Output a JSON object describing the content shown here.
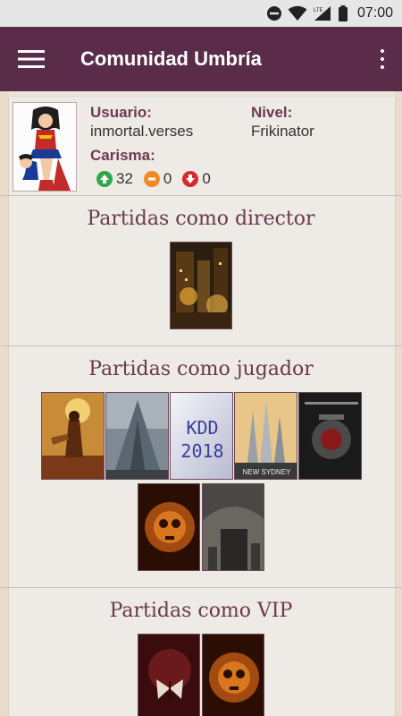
{
  "status_bar": {
    "time": "07:00",
    "icons": [
      "do-not-disturb-icon",
      "wifi-icon",
      "lte-signal-icon",
      "battery-icon"
    ],
    "network": "LTE"
  },
  "app_bar": {
    "title": "Comunidad Umbría",
    "menu_icon": "hamburger-menu-icon",
    "overflow_icon": "more-vertical-icon"
  },
  "profile": {
    "user_label": "Usuario:",
    "user_value": "inmortal.verses",
    "level_label": "Nivel:",
    "level_value": "Frikinator",
    "charisma_label": "Carisma:",
    "charisma": {
      "positive": "32",
      "neutral": "0",
      "negative": "0"
    }
  },
  "sections": {
    "director": {
      "title": "Partidas como director",
      "covers": [
        "game-cover-city-night"
      ]
    },
    "player": {
      "title": "Partidas como jugador",
      "covers": [
        "game-cover-desert-warrior",
        "game-cover-mountain-fortress",
        "game-cover-kdd-2018",
        "game-cover-new-sydney",
        "game-cover-steampunk",
        "game-cover-fire-skull",
        "game-cover-ruins"
      ]
    },
    "vip": {
      "title": "Partidas como VIP",
      "covers": [
        "game-cover-dark-butterfly",
        "game-cover-fire-skull-2"
      ]
    }
  },
  "cover_texts": {
    "kdd_line1": "KDD",
    "kdd_line2": "2018",
    "new_sydney": "NEW SYDNEY"
  },
  "colors": {
    "app_bar": "#5a2c4a",
    "label": "#6b3b52",
    "section_title": "#6a3850",
    "karma_positive": "#2fa84a",
    "karma_neutral": "#f08a24",
    "karma_negative": "#d72a2a"
  }
}
